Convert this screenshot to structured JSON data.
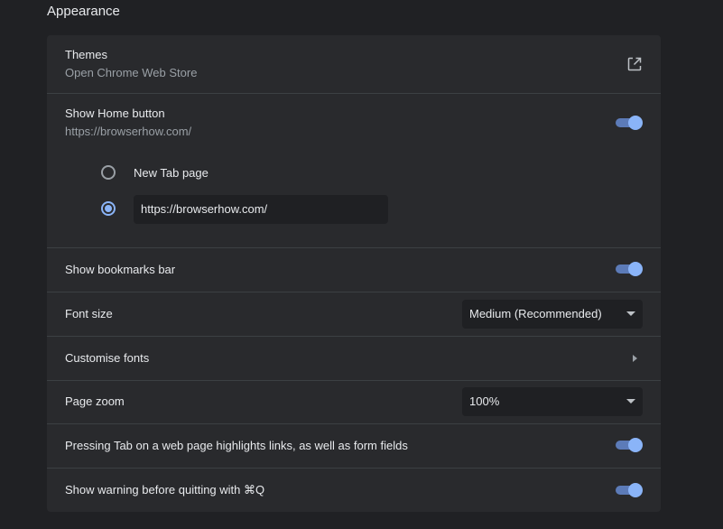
{
  "section": {
    "title": "Appearance"
  },
  "themes": {
    "label": "Themes",
    "sublabel": "Open Chrome Web Store",
    "icon": "open-in-new-icon"
  },
  "home_button": {
    "label": "Show Home button",
    "sublabel": "https://browserhow.com/",
    "enabled": true,
    "options": [
      {
        "label": "New Tab page",
        "selected": false
      },
      {
        "label": "",
        "selected": true
      }
    ],
    "custom_url_value": "https://browserhow.com/"
  },
  "bookmarks_bar": {
    "label": "Show bookmarks bar",
    "enabled": true
  },
  "font_size": {
    "label": "Font size",
    "selected": "Medium (Recommended)"
  },
  "customise_fonts": {
    "label": "Customise fonts",
    "icon": "chevron-right-icon"
  },
  "page_zoom": {
    "label": "Page zoom",
    "selected": "100%"
  },
  "tab_highlight": {
    "label": "Pressing Tab on a web page highlights links, as well as form fields",
    "enabled": true
  },
  "quit_warning": {
    "label": "Show warning before quitting with ⌘Q",
    "enabled": true
  },
  "colors": {
    "accent": "#8ab4f8",
    "card_bg": "#292a2d",
    "page_bg": "#202124"
  }
}
